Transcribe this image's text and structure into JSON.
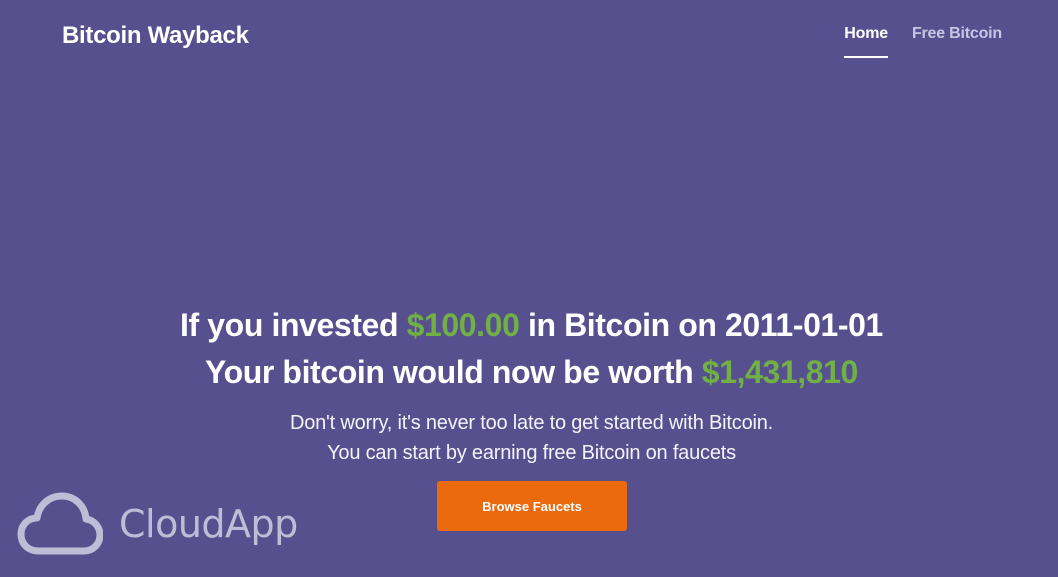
{
  "header": {
    "brand": "Bitcoin Wayback",
    "nav": [
      {
        "label": "Home",
        "active": true
      },
      {
        "label": "Free Bitcoin",
        "active": false
      }
    ]
  },
  "hero": {
    "line1_prefix": "If you invested ",
    "line1_amount": "$100.00",
    "line1_suffix": " in Bitcoin on 2011-01-01",
    "line2_prefix": "Your bitcoin would now be worth ",
    "line2_amount": "$1,431,810",
    "sub_line1": "Don't worry, it's never too late to get started with Bitcoin.",
    "sub_line2": "You can start by earning free Bitcoin on faucets",
    "button_label": "Browse Faucets"
  },
  "watermark": {
    "icon": "cloud-icon",
    "text": "CloudApp"
  },
  "colors": {
    "background": "#56508f",
    "accent_green": "#71b044",
    "button_orange": "#ea6a0c"
  }
}
